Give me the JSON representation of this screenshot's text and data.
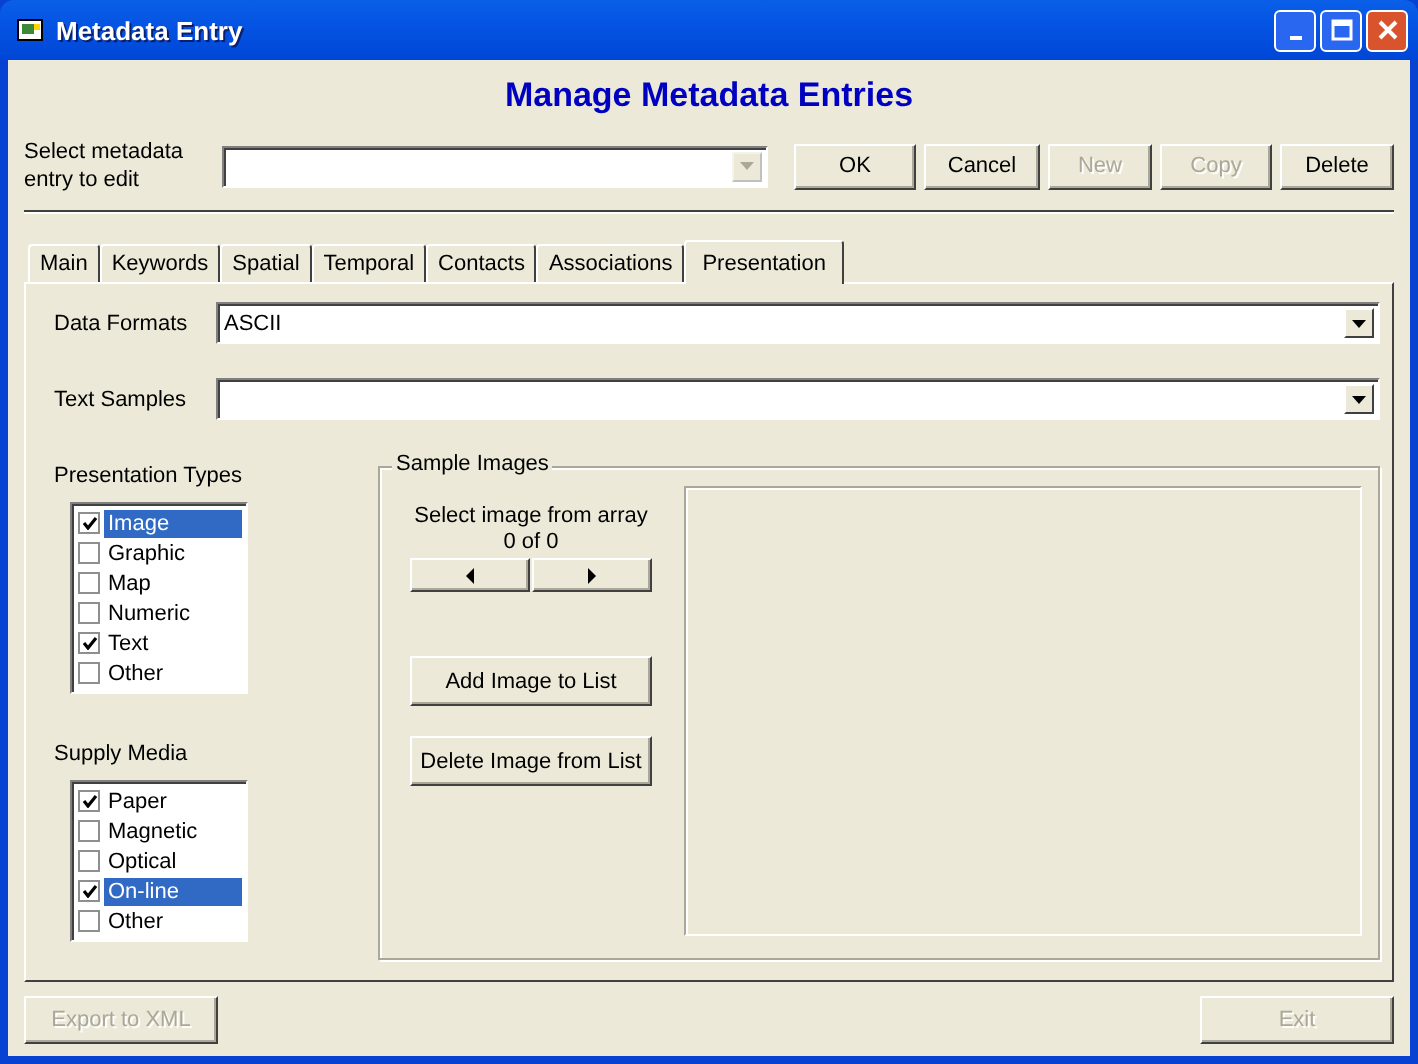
{
  "window": {
    "title": "Metadata Entry"
  },
  "heading": "Manage Metadata Entries",
  "entry_select": {
    "label": "Select metadata entry to edit"
  },
  "toolbar_buttons": [
    {
      "label": "OK",
      "disabled": false
    },
    {
      "label": "Cancel",
      "disabled": false
    },
    {
      "label": "New",
      "disabled": true
    },
    {
      "label": "Copy",
      "disabled": true
    },
    {
      "label": "Delete",
      "disabled": false
    }
  ],
  "tabs": [
    {
      "label": "Main",
      "selected": false
    },
    {
      "label": "Keywords",
      "selected": false
    },
    {
      "label": "Spatial",
      "selected": false
    },
    {
      "label": "Temporal",
      "selected": false
    },
    {
      "label": "Contacts",
      "selected": false
    },
    {
      "label": "Associations",
      "selected": false
    },
    {
      "label": "Presentation",
      "selected": true
    }
  ],
  "fields": [
    {
      "label": "Data Formats",
      "value": "ASCII"
    },
    {
      "label": "Text Samples"
    }
  ],
  "presentation_types": {
    "label": "Presentation Types",
    "items": [
      {
        "label": "Image",
        "checked": true,
        "selected": true
      },
      {
        "label": "Graphic",
        "checked": false,
        "selected": false
      },
      {
        "label": "Map",
        "checked": false,
        "selected": false
      },
      {
        "label": "Numeric",
        "checked": false,
        "selected": false
      },
      {
        "label": "Text",
        "checked": true,
        "selected": false
      },
      {
        "label": "Other",
        "checked": false,
        "selected": false
      }
    ]
  },
  "supply_media": {
    "label": "Supply Media",
    "items": [
      {
        "label": "Paper",
        "checked": true,
        "selected": false
      },
      {
        "label": "Magnetic",
        "checked": false,
        "selected": false
      },
      {
        "label": "Optical",
        "checked": false,
        "selected": false
      },
      {
        "label": "On-line",
        "checked": true,
        "selected": true
      },
      {
        "label": "Other",
        "checked": false,
        "selected": false
      }
    ]
  },
  "sample_images": {
    "title": "Sample Images",
    "caption": "Select image from array",
    "counter": "0 of 0",
    "buttons": [
      {
        "label": "Add Image to List",
        "disabled": false
      },
      {
        "label": "Delete Image from List",
        "disabled": false
      }
    ]
  },
  "footer_buttons": [
    {
      "label": "Export to XML",
      "disabled": true
    },
    {
      "label": "Exit",
      "disabled": true
    }
  ]
}
